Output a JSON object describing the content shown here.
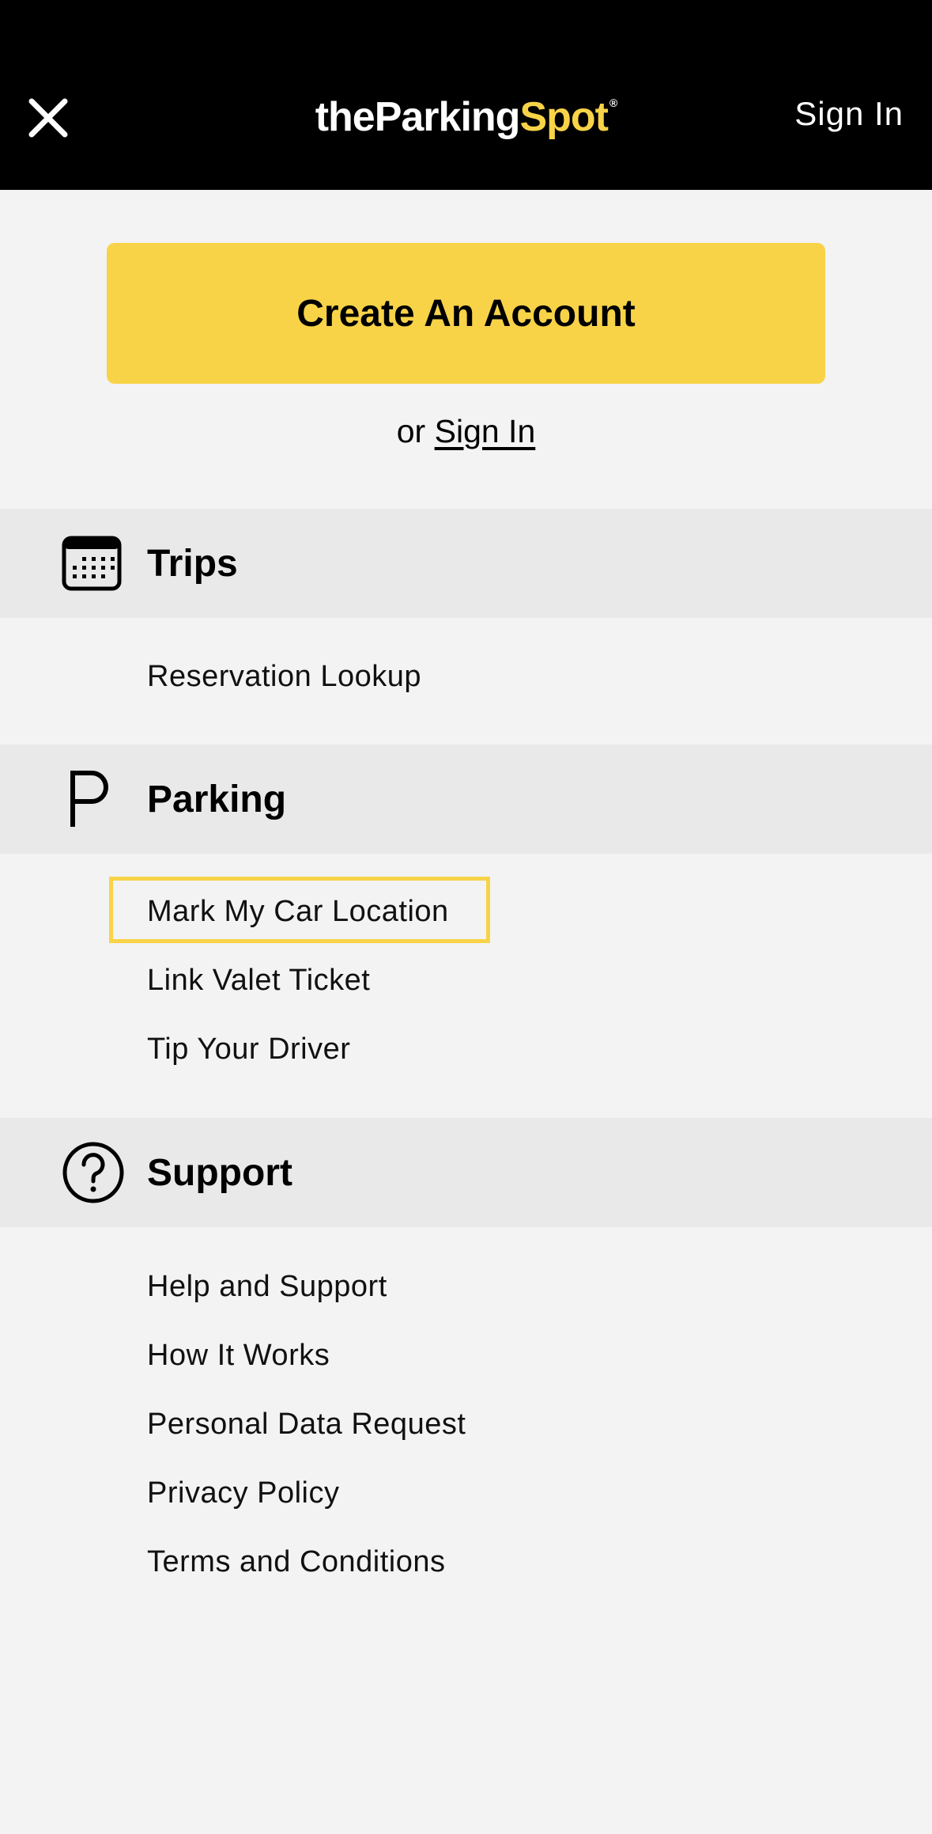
{
  "header": {
    "logo_part1": "theParking",
    "logo_part2": "Spot",
    "logo_mark": "®",
    "sign_in": "Sign In",
    "close_icon": "close-icon"
  },
  "cta": {
    "create_account": "Create An Account",
    "or_text": "or",
    "sign_in_link": "Sign In"
  },
  "sections": {
    "trips": {
      "title": "Trips",
      "icon": "calendar-icon",
      "items": [
        "Reservation Lookup"
      ]
    },
    "parking": {
      "title": "Parking",
      "icon": "parking-icon",
      "icon_glyph": "P",
      "items": [
        "Mark My Car Location",
        "Link Valet Ticket",
        "Tip Your Driver"
      ]
    },
    "support": {
      "title": "Support",
      "icon": "help-circle-icon",
      "items": [
        "Help and Support",
        "How It Works",
        "Personal Data Request",
        "Privacy Policy",
        "Terms and Conditions"
      ]
    }
  },
  "colors": {
    "accent": "#f8d347",
    "header_bg": "#000000",
    "page_bg": "#f3f3f3",
    "section_bg": "#e9e9e9"
  }
}
